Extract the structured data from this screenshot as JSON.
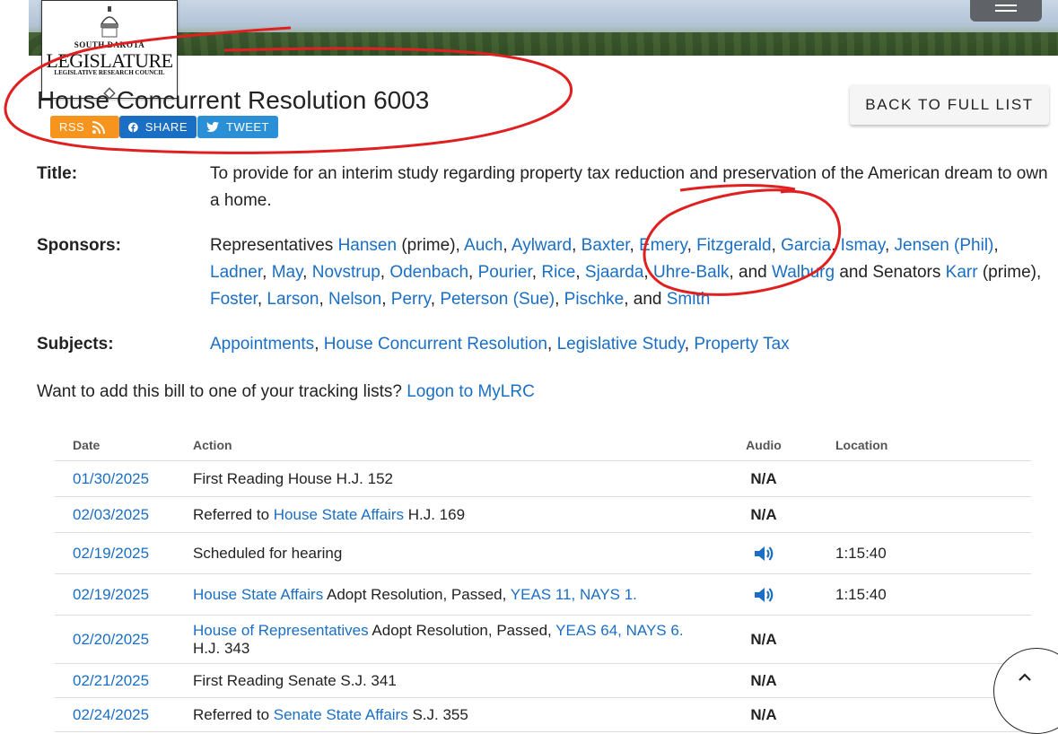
{
  "header": {
    "logo": {
      "line1": "South Dakota",
      "line2": "Legislature",
      "line3": "Legislative Research Council"
    },
    "menu_icon": "hamburger-icon"
  },
  "page": {
    "title": "House Concurrent Resolution 6003",
    "back_label": "BACK TO FULL LIST"
  },
  "share": {
    "rss_label": "RSS",
    "facebook_label": "SHARE",
    "twitter_label": "TWEET"
  },
  "fields": {
    "title_label": "Title:",
    "title_value": "To provide for an interim study regarding property tax reduction and preservation of the American dream to own a home.",
    "sponsors_label": "Sponsors:",
    "sponsors": {
      "prefix": "Representatives ",
      "representatives": [
        "Hansen",
        "Auch",
        "Aylward",
        "Baxter",
        "Emery",
        "Fitzgerald",
        "Garcia",
        "Ismay",
        "Jensen (Phil)",
        "Ladner",
        "May",
        "Novstrup",
        "Odenbach",
        "Pourier",
        "Rice",
        "Sjaarda",
        "Uhre-Balk",
        "Walburg"
      ],
      "prime_suffix": " (prime)",
      "and_senators": " and Senators ",
      "senators": [
        "Karr",
        "Foster",
        "Larson",
        "Nelson",
        "Perry",
        "Peterson (Sue)",
        "Pischke",
        "Smith"
      ]
    },
    "subjects_label": "Subjects:",
    "subjects": [
      "Appointments",
      "House Concurrent Resolution",
      "Legislative Study",
      "Property Tax"
    ]
  },
  "tracking": {
    "text": "Want to add this bill to one of your tracking lists? ",
    "link": "Logon to MyLRC"
  },
  "table": {
    "headers": {
      "date": "Date",
      "action": "Action",
      "audio": "Audio",
      "location": "Location"
    },
    "rows": [
      {
        "date": "01/30/2025",
        "action": "First Reading House H.J. 152",
        "audio": "N/A",
        "location": ""
      },
      {
        "date": "02/03/2025",
        "action_pre": "Referred to ",
        "action_link": "House State Affairs",
        "action_post": " H.J. 169",
        "audio": "N/A",
        "location": ""
      },
      {
        "date": "02/19/2025",
        "action": "Scheduled for hearing",
        "audio": "speaker-icon",
        "location": "1:15:40"
      },
      {
        "date": "02/19/2025",
        "action_link": "House State Affairs",
        "action_post": " Adopt Resolution, Passed, ",
        "action_vote": "YEAS 11, NAYS 1.",
        "audio": "speaker-icon",
        "location": "1:15:40"
      },
      {
        "date": "02/20/2025",
        "action_link": "House of Representatives",
        "action_post": " Adopt Resolution, Passed, ",
        "action_vote": "YEAS 64, NAYS 6.",
        "action_tail": "H.J. 343",
        "audio": "N/A",
        "location": ""
      },
      {
        "date": "02/21/2025",
        "action": "First Reading Senate S.J. 341",
        "audio": "N/A",
        "location": ""
      },
      {
        "date": "02/24/2025",
        "action_pre": "Referred to ",
        "action_link": "Senate State Affairs",
        "action_post": " S.J. 355",
        "audio": "N/A",
        "location": ""
      }
    ]
  },
  "colors": {
    "link": "#1a6fc4",
    "rss": "#f7941d",
    "facebook": "#1a6fc4",
    "twitter": "#2b8fd6",
    "annotation": "#e02020"
  },
  "scroll_top_icon": "chevron-up-icon"
}
